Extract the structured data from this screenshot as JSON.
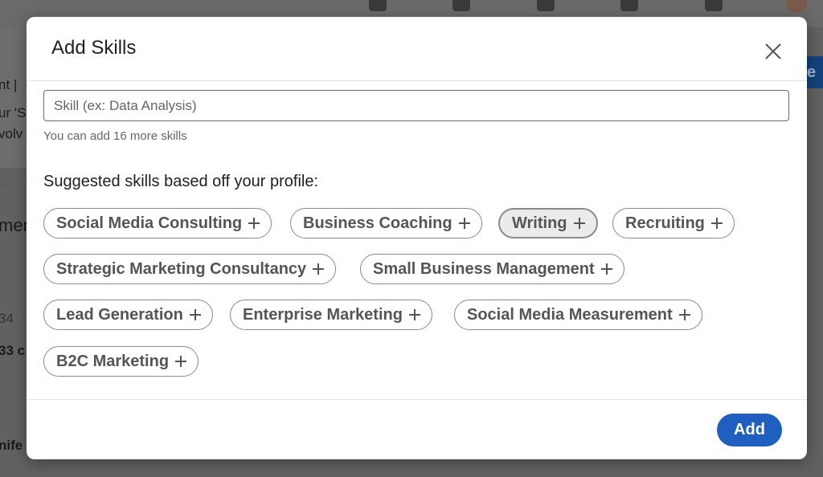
{
  "background": {
    "fragments": [
      "nt |",
      "ur 'S",
      "volv",
      "mer",
      "34",
      "33 c",
      "nife"
    ],
    "button_fragment": "e s"
  },
  "modal": {
    "title": "Add Skills",
    "close_icon": "close-icon",
    "input": {
      "placeholder": "Skill (ex: Data Analysis)",
      "value": ""
    },
    "helper": "You can add 16 more skills",
    "suggest_label": "Suggested skills based off your profile:",
    "skills": [
      "Social Media Consulting",
      "Business Coaching",
      "Writing",
      "Recruiting",
      "Strategic Marketing Consultancy",
      "Small Business Management",
      "Lead Generation",
      "Enterprise Marketing",
      "Social Media Measurement",
      "B2C Marketing"
    ],
    "add_label": "Add",
    "accent_color": "#1e5fbf"
  }
}
